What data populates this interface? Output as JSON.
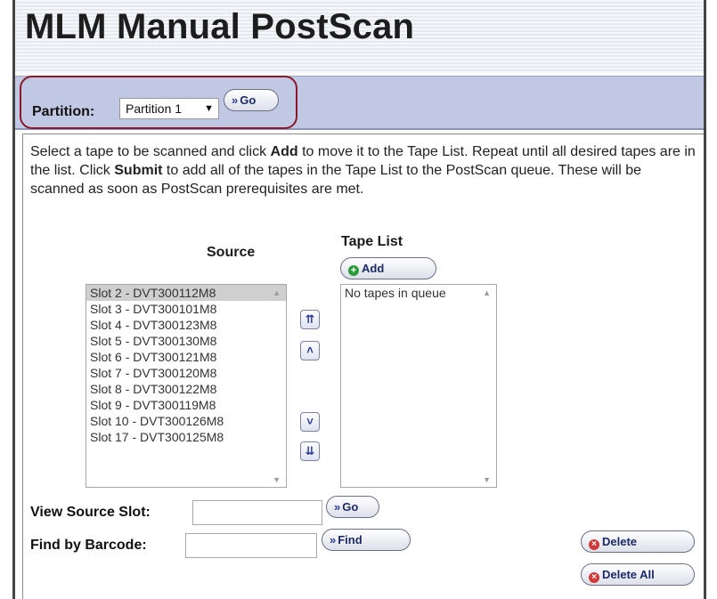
{
  "page": {
    "title": "MLM Manual PostScan"
  },
  "partition": {
    "label": "Partition:",
    "selected": "Partition 1",
    "go_label": "Go"
  },
  "instructions": {
    "part1": "Select a tape to be scanned and click ",
    "add_word": "Add",
    "part2": " to move it to the Tape List. Repeat until all desired tapes are in the list. Click ",
    "submit_word": "Submit",
    "part3": " to add all of the tapes in the Tape List to the PostScan queue. These will be scanned as soon as PostScan prerequisites are met."
  },
  "source": {
    "title": "Source",
    "items": [
      "Slot 2 - DVT300112M8",
      "Slot 3 - DVT300101M8",
      "Slot 4 - DVT300123M8",
      "Slot 5 - DVT300130M8",
      "Slot 6 - DVT300121M8",
      "Slot 7 - DVT300120M8",
      "Slot 8 - DVT300122M8",
      "Slot 9 - DVT300119M8",
      "Slot 10 - DVT300126M8",
      "Slot 17 - DVT300125M8"
    ]
  },
  "tape_list": {
    "title": "Tape List",
    "add_label": "Add",
    "empty_text": "No tapes in queue"
  },
  "move_buttons": {
    "top": "top-icon",
    "up": "up-icon",
    "down": "down-icon",
    "bottom": "bottom-icon"
  },
  "view_slot": {
    "label": "View Source Slot:",
    "value": "",
    "go_label": "Go"
  },
  "find_barcode": {
    "label": "Find by Barcode:",
    "value": "",
    "find_label": "Find"
  },
  "actions": {
    "delete_label": "Delete",
    "delete_all_label": "Delete All"
  },
  "colors": {
    "band": "#c1c8e3",
    "highlight": "#8a1a2a",
    "accent": "#2d3b9a"
  }
}
